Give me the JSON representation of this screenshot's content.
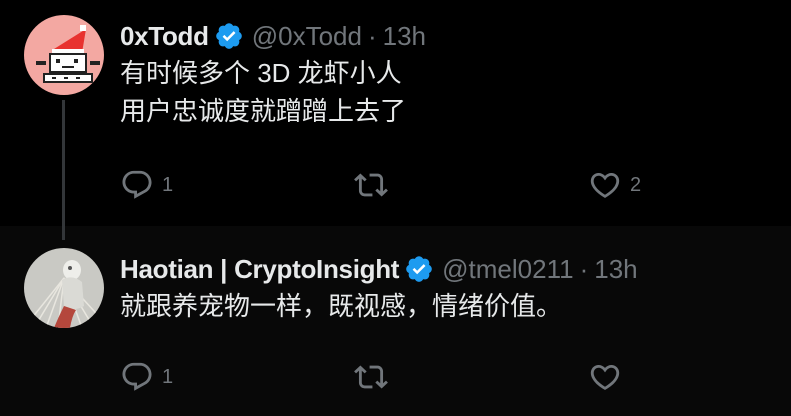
{
  "colors": {
    "background": "#000000",
    "reply_background": "#080808",
    "text_primary": "#e7e9ea",
    "text_secondary": "#71767b",
    "verified_blue": "#1d9bf0",
    "thread_line": "#333639"
  },
  "tweets": [
    {
      "name": "0xTodd",
      "handle": "@0xTodd",
      "separator": "·",
      "time": "13h",
      "verified": true,
      "text_lines": [
        "有时候多个 3D 龙虾小人",
        "用户忠诚度就蹭蹭上去了"
      ],
      "actions": {
        "reply_icon": "reply-icon",
        "reply_count": "1",
        "retweet_icon": "retweet-icon",
        "retweet_count": "",
        "like_icon": "heart-icon",
        "like_count": "2"
      }
    },
    {
      "name": "Haotian | CryptoInsight",
      "handle": "@tmel0211",
      "separator": "·",
      "time": "13h",
      "verified": true,
      "text_lines": [
        "就跟养宠物一样，既视感，情绪价值。"
      ],
      "actions": {
        "reply_icon": "reply-icon",
        "reply_count": "1",
        "retweet_icon": "retweet-icon",
        "retweet_count": "",
        "like_icon": "heart-icon",
        "like_count": ""
      }
    }
  ]
}
